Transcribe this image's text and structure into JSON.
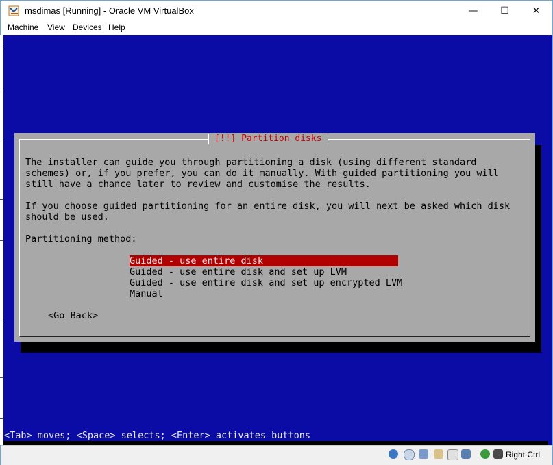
{
  "window": {
    "title": "msdimas [Running] - Oracle VM VirtualBox",
    "controls": {
      "minimize": "—",
      "maximize": "☐",
      "close": "✕"
    }
  },
  "menu": [
    "Machine",
    "View",
    "Devices",
    "Help"
  ],
  "dialog": {
    "title": "[!!] Partition disks",
    "paragraph1": [
      "The installer can guide you through partitioning a disk (using different standard",
      "schemes) or, if you prefer, you can do it manually. With guided partitioning you will",
      "still have a chance later to review and customise the results."
    ],
    "paragraph2": [
      "If you choose guided partitioning for an entire disk, you will next be asked which disk",
      "should be used."
    ],
    "method_label": "Partitioning method:",
    "options": [
      "Guided - use entire disk",
      "Guided - use entire disk and set up LVM",
      "Guided - use entire disk and set up encrypted LVM",
      "Manual"
    ],
    "selected_option": 0,
    "back_button": "<Go Back>"
  },
  "hint": "<Tab> moves; <Space> selects; <Enter> activates buttons",
  "statusbar": {
    "host_key": "Right Ctrl",
    "icons": [
      "hard-disk-icon",
      "optical-drive-icon",
      "usb-icon",
      "shared-folders-icon",
      "display-icon",
      "video-capture-icon",
      "network-icon",
      "mouse-integration-icon"
    ]
  },
  "colors": {
    "screen_bg": "#0b0ba6",
    "dialog_bg": "#a8a8a8",
    "title_red": "#c80000",
    "selection": "#b00000"
  }
}
